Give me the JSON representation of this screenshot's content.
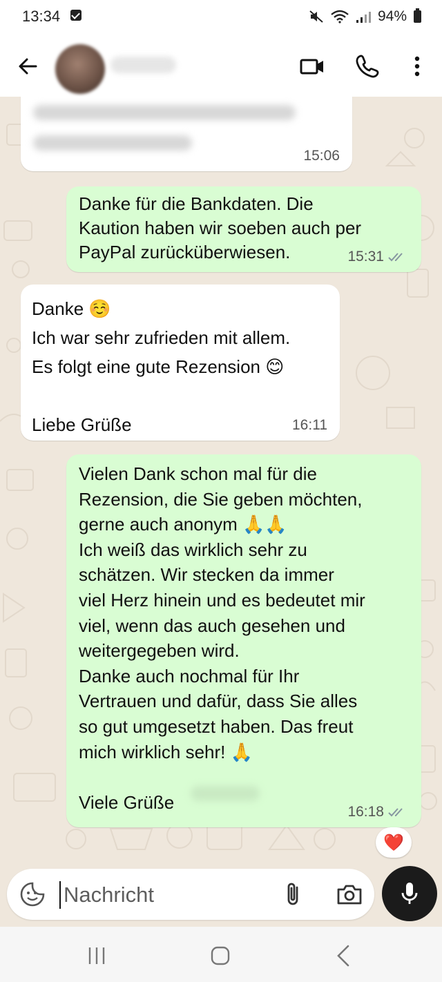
{
  "status_bar": {
    "time": "13:34",
    "battery": "94%"
  },
  "header": {
    "contact_name": ""
  },
  "messages": [
    {
      "direction": "incoming",
      "text": "",
      "time": "15:06"
    },
    {
      "direction": "outgoing",
      "text": "Danke für die Bankdaten. Die\nKaution haben wir soeben auch per\nPayPal zurücküberwiesen.",
      "time": "15:31",
      "status": "read"
    },
    {
      "direction": "incoming",
      "text": "Danke ☺️\nIch war sehr zufrieden mit allem.\nEs folgt eine gute Rezension 😊\n\nLiebe Grüße",
      "time": "16:11"
    },
    {
      "direction": "outgoing",
      "text": "Vielen Dank schon mal für die\nRezension, die Sie geben möchten,\ngerne auch anonym 🙏🙏\nIch weiß das wirklich sehr zu\nschätzen. Wir stecken da immer\nviel Herz hinein und es bedeutet mir\nviel, wenn das auch gesehen und\nweitergegeben wird.\nDanke auch nochmal für Ihr\nVertrauen und dafür, dass Sie alles\nso gut umgesetzt haben. Das freut\nmich wirklich sehr! 🙏\n\nViele Grüße",
      "time": "16:18",
      "status": "read",
      "reaction": "❤️"
    }
  ],
  "composer": {
    "placeholder": "Nachricht"
  },
  "colors": {
    "incoming_bubble": "#ffffff",
    "outgoing_bubble": "#d9fdd3",
    "wallpaper": "#efe7dc",
    "read_ticks": "#8696a0",
    "mic_button": "#1b1b1b"
  },
  "icons": {
    "back": "arrow-left-icon",
    "video": "video-call-icon",
    "call": "phone-icon",
    "menu": "more-vert-icon",
    "emoji": "sticker-icon",
    "attach": "paperclip-icon",
    "camera": "camera-icon",
    "mic": "microphone-icon"
  }
}
